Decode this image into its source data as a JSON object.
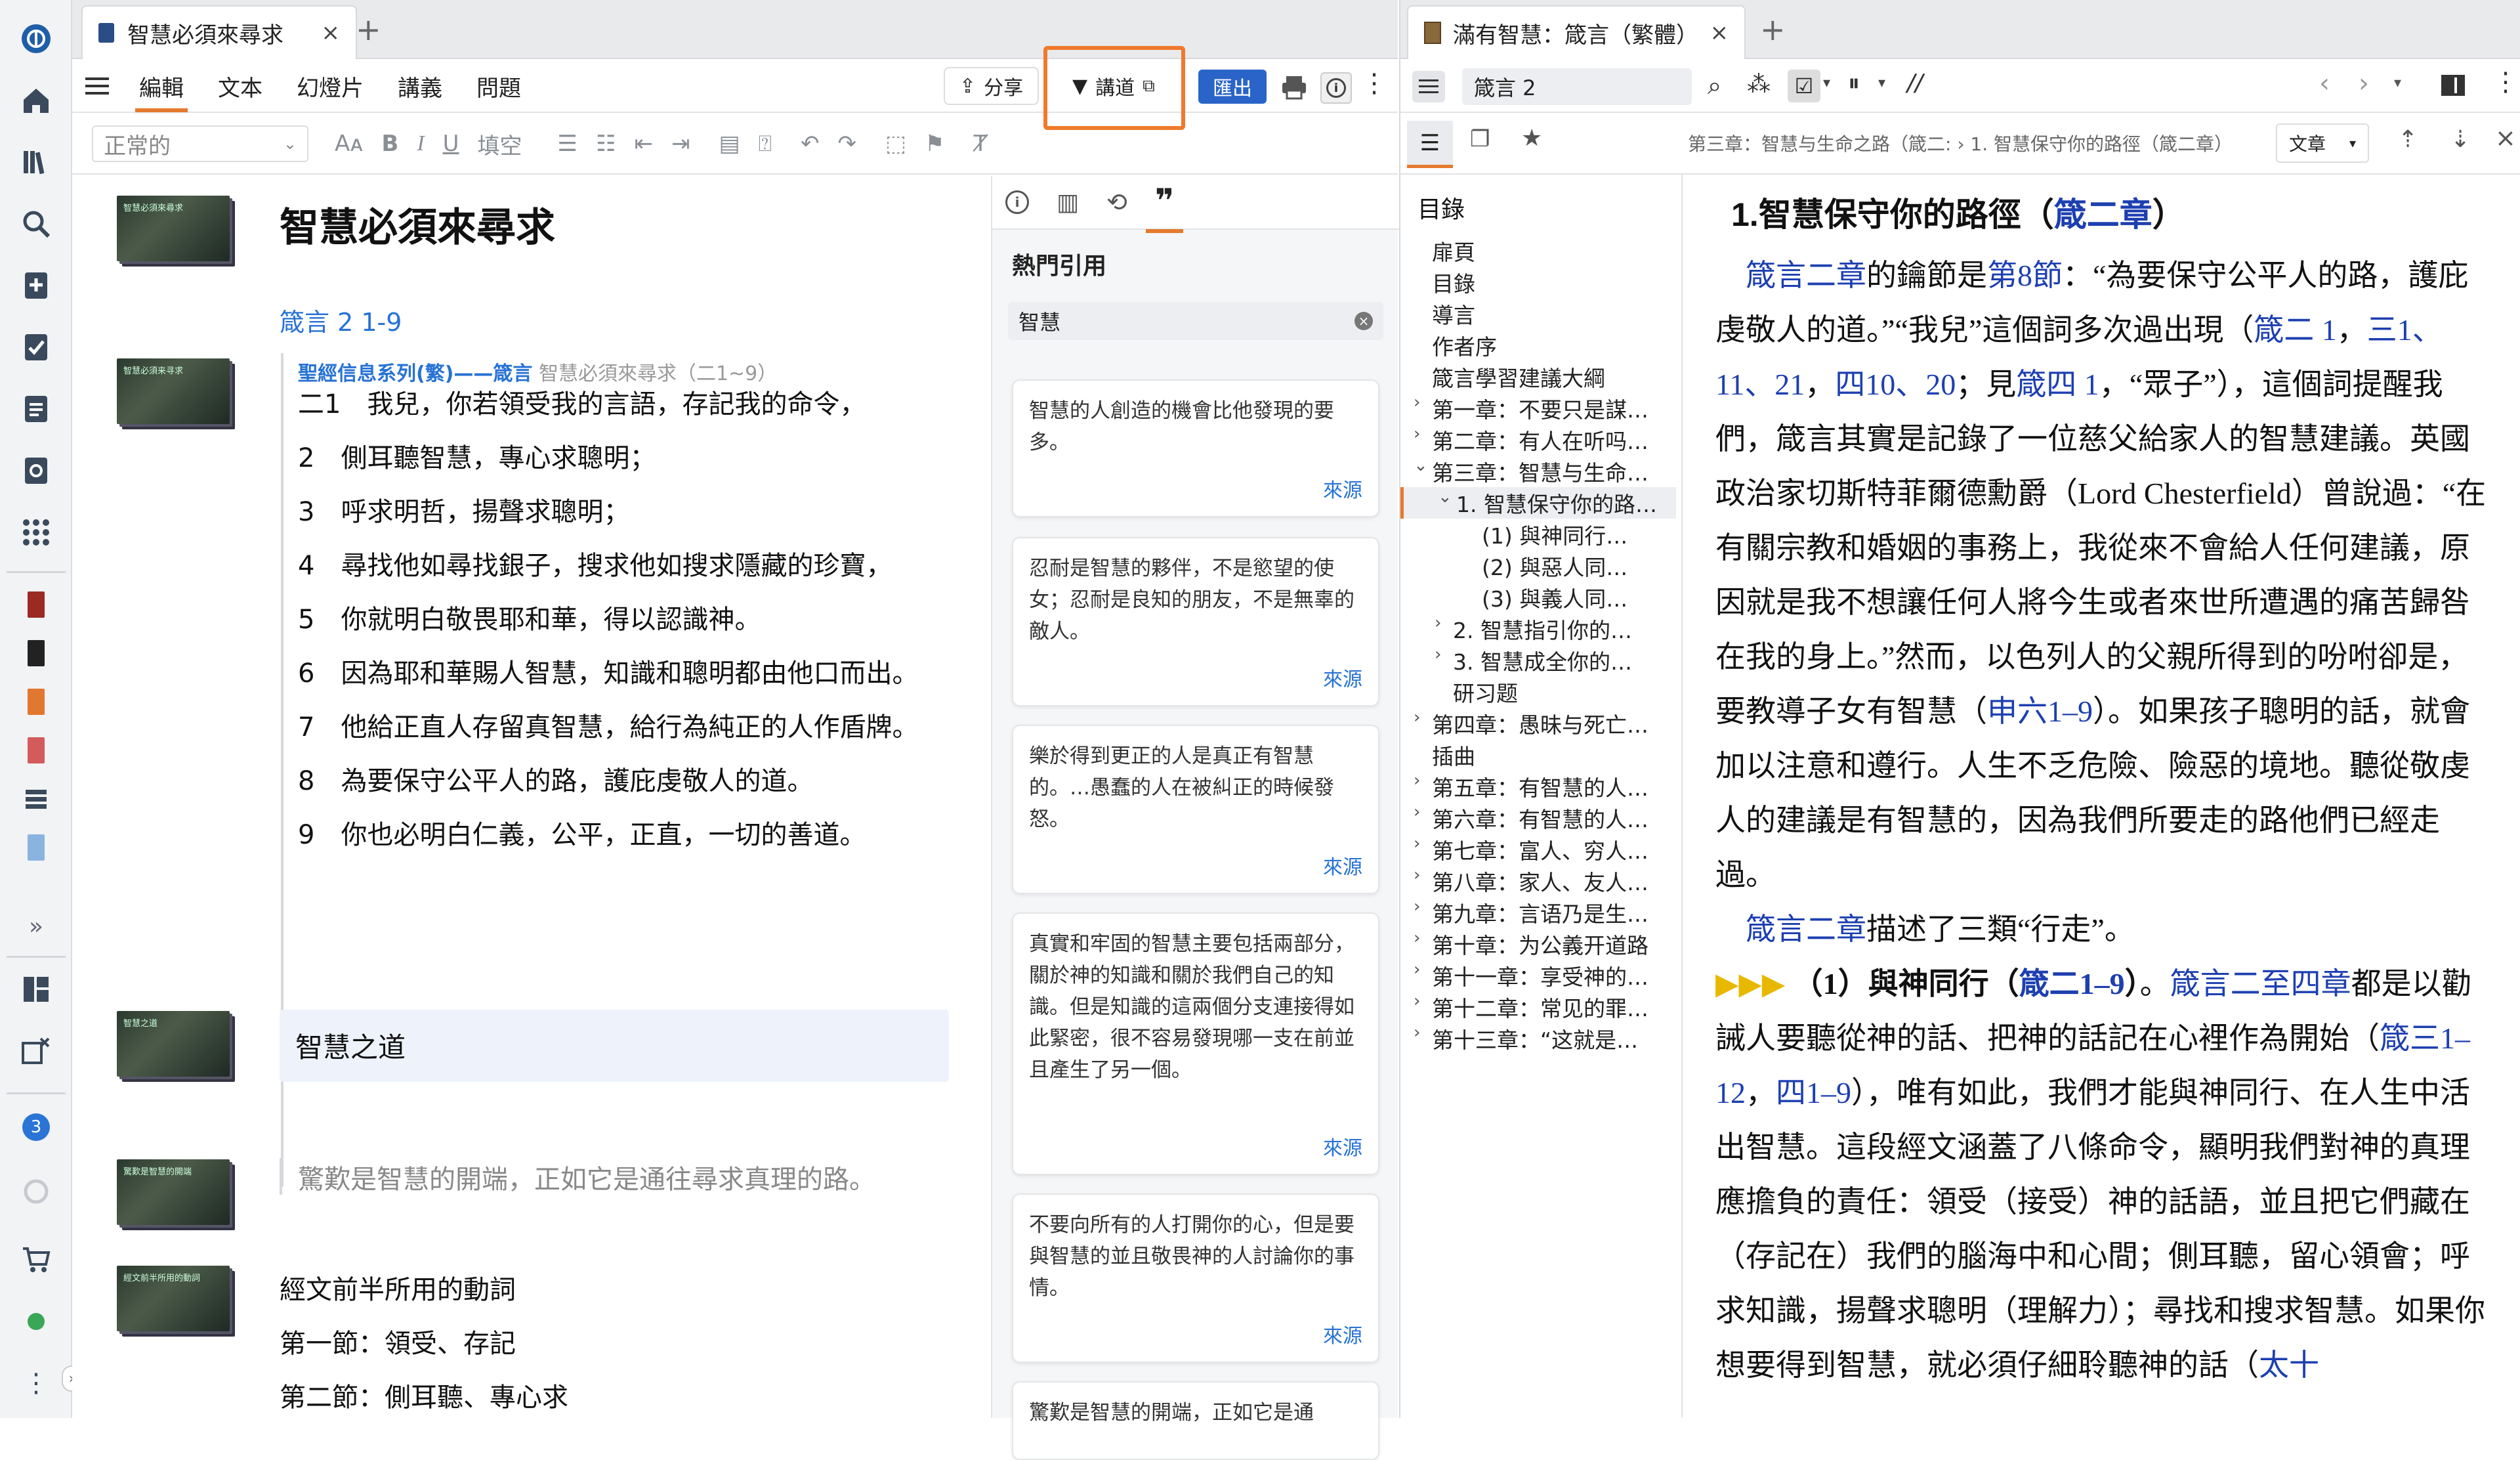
{
  "left_tab": {
    "title": "智慧必須來尋求",
    "close": "×",
    "plus": "+"
  },
  "left_toolbar": {
    "menu": [
      "編輯",
      "文本",
      "幻燈片",
      "講義",
      "問題"
    ],
    "share": "分享",
    "preach": "講道",
    "export": "匯出"
  },
  "format_bar": {
    "style": "正常的",
    "fill": "填空"
  },
  "doc": {
    "title": "智慧必須來尋求",
    "ref": "箴言 2 1-9",
    "series_link": "聖經信息系列(繁)——箴言",
    "series_rest": " 智慧必須來尋求（二1~9）",
    "verses": [
      "二1　我兒，你若領受我的言語，存記我的命令，",
      "2　側耳聽智慧，專心求聰明；",
      "3　呼求明哲，揚聲求聰明；",
      "4　尋找他如尋找銀子，搜求他如搜求隱藏的珍寶，",
      "5　你就明白敬畏耶和華，得以認識神。",
      "6　因為耶和華賜人智慧，知識和聰明都由他口而出。",
      "7　他給正直人存留真智慧，給行為純正的人作盾牌。",
      "8　為要保守公平人的路，護庇虔敬人的道。",
      "9　你也必明白仁義，公平，正直，一切的善道。"
    ],
    "heading2": "智慧之道",
    "quote": "驚歎是智慧的開端，正如它是通往尋求真理的路。",
    "para": [
      "經文前半所用的動詞",
      "第一節：領受、存記",
      "第二節：側耳聽、專心求"
    ],
    "thumb_texts": [
      "智慧必須來尋求",
      "智慧必須来寻求",
      "智慧之道",
      "驚歎是智慧的開端",
      "經文前半所用的動詞"
    ]
  },
  "quotes_panel": {
    "title": "熱門引用",
    "search": "智慧",
    "cards": [
      {
        "text": "智慧的人創造的機會比他發現的要多。",
        "src": "來源"
      },
      {
        "text": "忍耐是智慧的夥伴，不是慾望的使女；忍耐是良知的朋友，不是無辜的敵人。",
        "src": "來源"
      },
      {
        "text": "樂於得到更正的人是真正有智慧的。…愚蠢的人在被糾正的時候發怒。",
        "src": "來源"
      },
      {
        "text": "真實和牢固的智慧主要包括兩部分，關於神的知識和關於我們自己的知識。但是知識的這兩個分支連接得如此緊密，很不容易發現哪一支在前並且產生了另一個。",
        "src": "來源"
      },
      {
        "text": "不要向所有的人打開你的心，但是要與智慧的並且敬畏神的人討論你的事情。",
        "src": "來源"
      },
      {
        "text": "驚歎是智慧的開端，正如它是通",
        "src": ""
      }
    ]
  },
  "right_tab": {
    "title": "滿有智慧：箴言（繁體）",
    "close": "×",
    "plus": "+"
  },
  "right_toolbar": {
    "ref": "箴言 2",
    "breadcrumb": "第三章：智慧与生命之路（箴二: › 1. 智慧保守你的路徑（箴二章）",
    "view": "文章"
  },
  "toc": {
    "title": "目錄",
    "items": [
      {
        "t": "扉頁",
        "lvl": 0,
        "arrow": ""
      },
      {
        "t": "目錄",
        "lvl": 0,
        "arrow": ""
      },
      {
        "t": "導言",
        "lvl": 0,
        "arrow": ""
      },
      {
        "t": "作者序",
        "lvl": 0,
        "arrow": ""
      },
      {
        "t": "箴言學習建議大綱",
        "lvl": 0,
        "arrow": ""
      },
      {
        "t": "第一章：不要只是謀…",
        "lvl": 0,
        "arrow": "›"
      },
      {
        "t": "第二章：有人在听吗…",
        "lvl": 0,
        "arrow": "›"
      },
      {
        "t": "第三章：智慧与生命…",
        "lvl": 0,
        "arrow": "⌄"
      },
      {
        "t": "1. 智慧保守你的路…",
        "lvl": 1,
        "arrow": "⌄"
      },
      {
        "t": "(1) 與神同行…",
        "lvl": 2,
        "arrow": ""
      },
      {
        "t": "(2) 與惡人同…",
        "lvl": 2,
        "arrow": ""
      },
      {
        "t": "(3) 與義人同…",
        "lvl": 2,
        "arrow": ""
      },
      {
        "t": "2. 智慧指引你的道…",
        "lvl": 1,
        "arrow": "›"
      },
      {
        "t": "3. 智慧成全你的道…",
        "lvl": 1,
        "arrow": "›"
      },
      {
        "t": "研习题",
        "lvl": 1,
        "arrow": ""
      },
      {
        "t": "第四章：愚昧与死亡…",
        "lvl": 0,
        "arrow": "›"
      },
      {
        "t": "插曲",
        "lvl": 0,
        "arrow": ""
      },
      {
        "t": "第五章：有智慧的人…",
        "lvl": 0,
        "arrow": "›"
      },
      {
        "t": "第六章：有智慧的人…",
        "lvl": 0,
        "arrow": "›"
      },
      {
        "t": "第七章：富人、穷人…",
        "lvl": 0,
        "arrow": "›"
      },
      {
        "t": "第八章：家人、友人…",
        "lvl": 0,
        "arrow": "›"
      },
      {
        "t": "第九章：言语乃是生…",
        "lvl": 0,
        "arrow": "›"
      },
      {
        "t": "第十章：为公義开道路",
        "lvl": 0,
        "arrow": "›"
      },
      {
        "t": "第十一章：享受神的…",
        "lvl": 0,
        "arrow": "›"
      },
      {
        "t": "第十二章：常见的罪…",
        "lvl": 0,
        "arrow": "›"
      },
      {
        "t": "第十三章：“这就是我…",
        "lvl": 0,
        "arrow": "›"
      }
    ]
  },
  "reader": {
    "heading_pre": "1.智慧保守你的路徑（",
    "heading_link": "箴二章",
    "heading_post": "）"
  },
  "rail_badge": "3"
}
